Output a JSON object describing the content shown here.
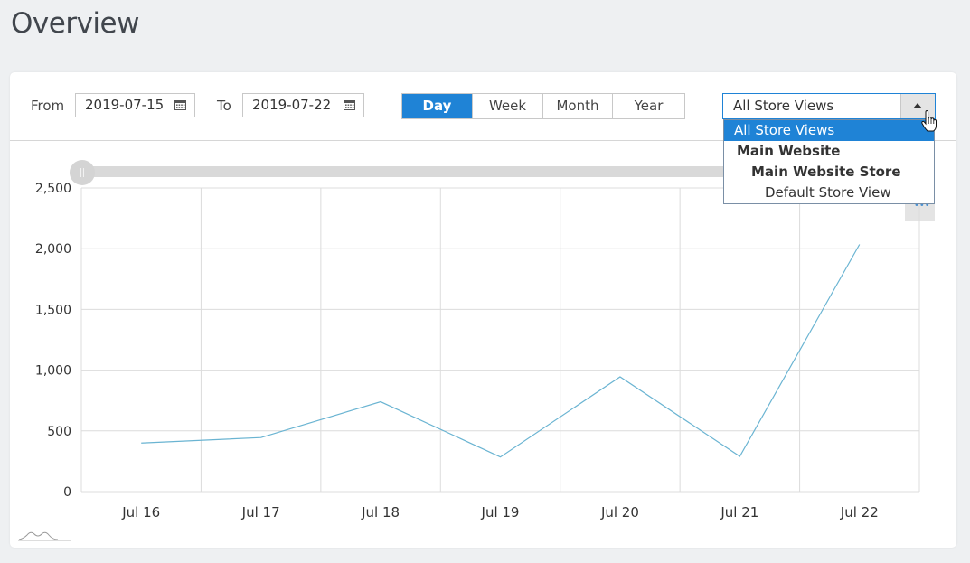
{
  "page": {
    "title": "Overview"
  },
  "filters": {
    "from_label": "From",
    "from_value": "2019-07-15",
    "to_label": "To",
    "to_value": "2019-07-22",
    "calendar_icon": "calendar-icon"
  },
  "periods": [
    {
      "label": "Day",
      "active": true
    },
    {
      "label": "Week",
      "active": false
    },
    {
      "label": "Month",
      "active": false
    },
    {
      "label": "Year",
      "active": false
    }
  ],
  "store_select": {
    "value": "All Store Views",
    "options": [
      {
        "label": "All Store Views",
        "selected": true,
        "bold": false,
        "level": 0
      },
      {
        "label": "Main Website",
        "selected": false,
        "bold": true,
        "level": 1
      },
      {
        "label": "Main Website Store",
        "selected": false,
        "bold": true,
        "level": 2
      },
      {
        "label": "Default Store View",
        "selected": false,
        "bold": false,
        "level": 3
      }
    ]
  },
  "colors": {
    "accent": "#1f83d6",
    "line": "#6ab4d2",
    "grid": "#dcdcdc"
  },
  "chart_data": {
    "type": "line",
    "categories": [
      "Jul 16",
      "Jul 17",
      "Jul 18",
      "Jul 19",
      "Jul 20",
      "Jul 21",
      "Jul 22"
    ],
    "series": [
      {
        "values": [
          400,
          445,
          740,
          285,
          945,
          290,
          2035
        ]
      }
    ],
    "y_ticks": [
      "0",
      "500",
      "1,000",
      "1,500",
      "2,000",
      "2,500"
    ],
    "ylim": [
      0,
      2500
    ],
    "grid": true
  }
}
